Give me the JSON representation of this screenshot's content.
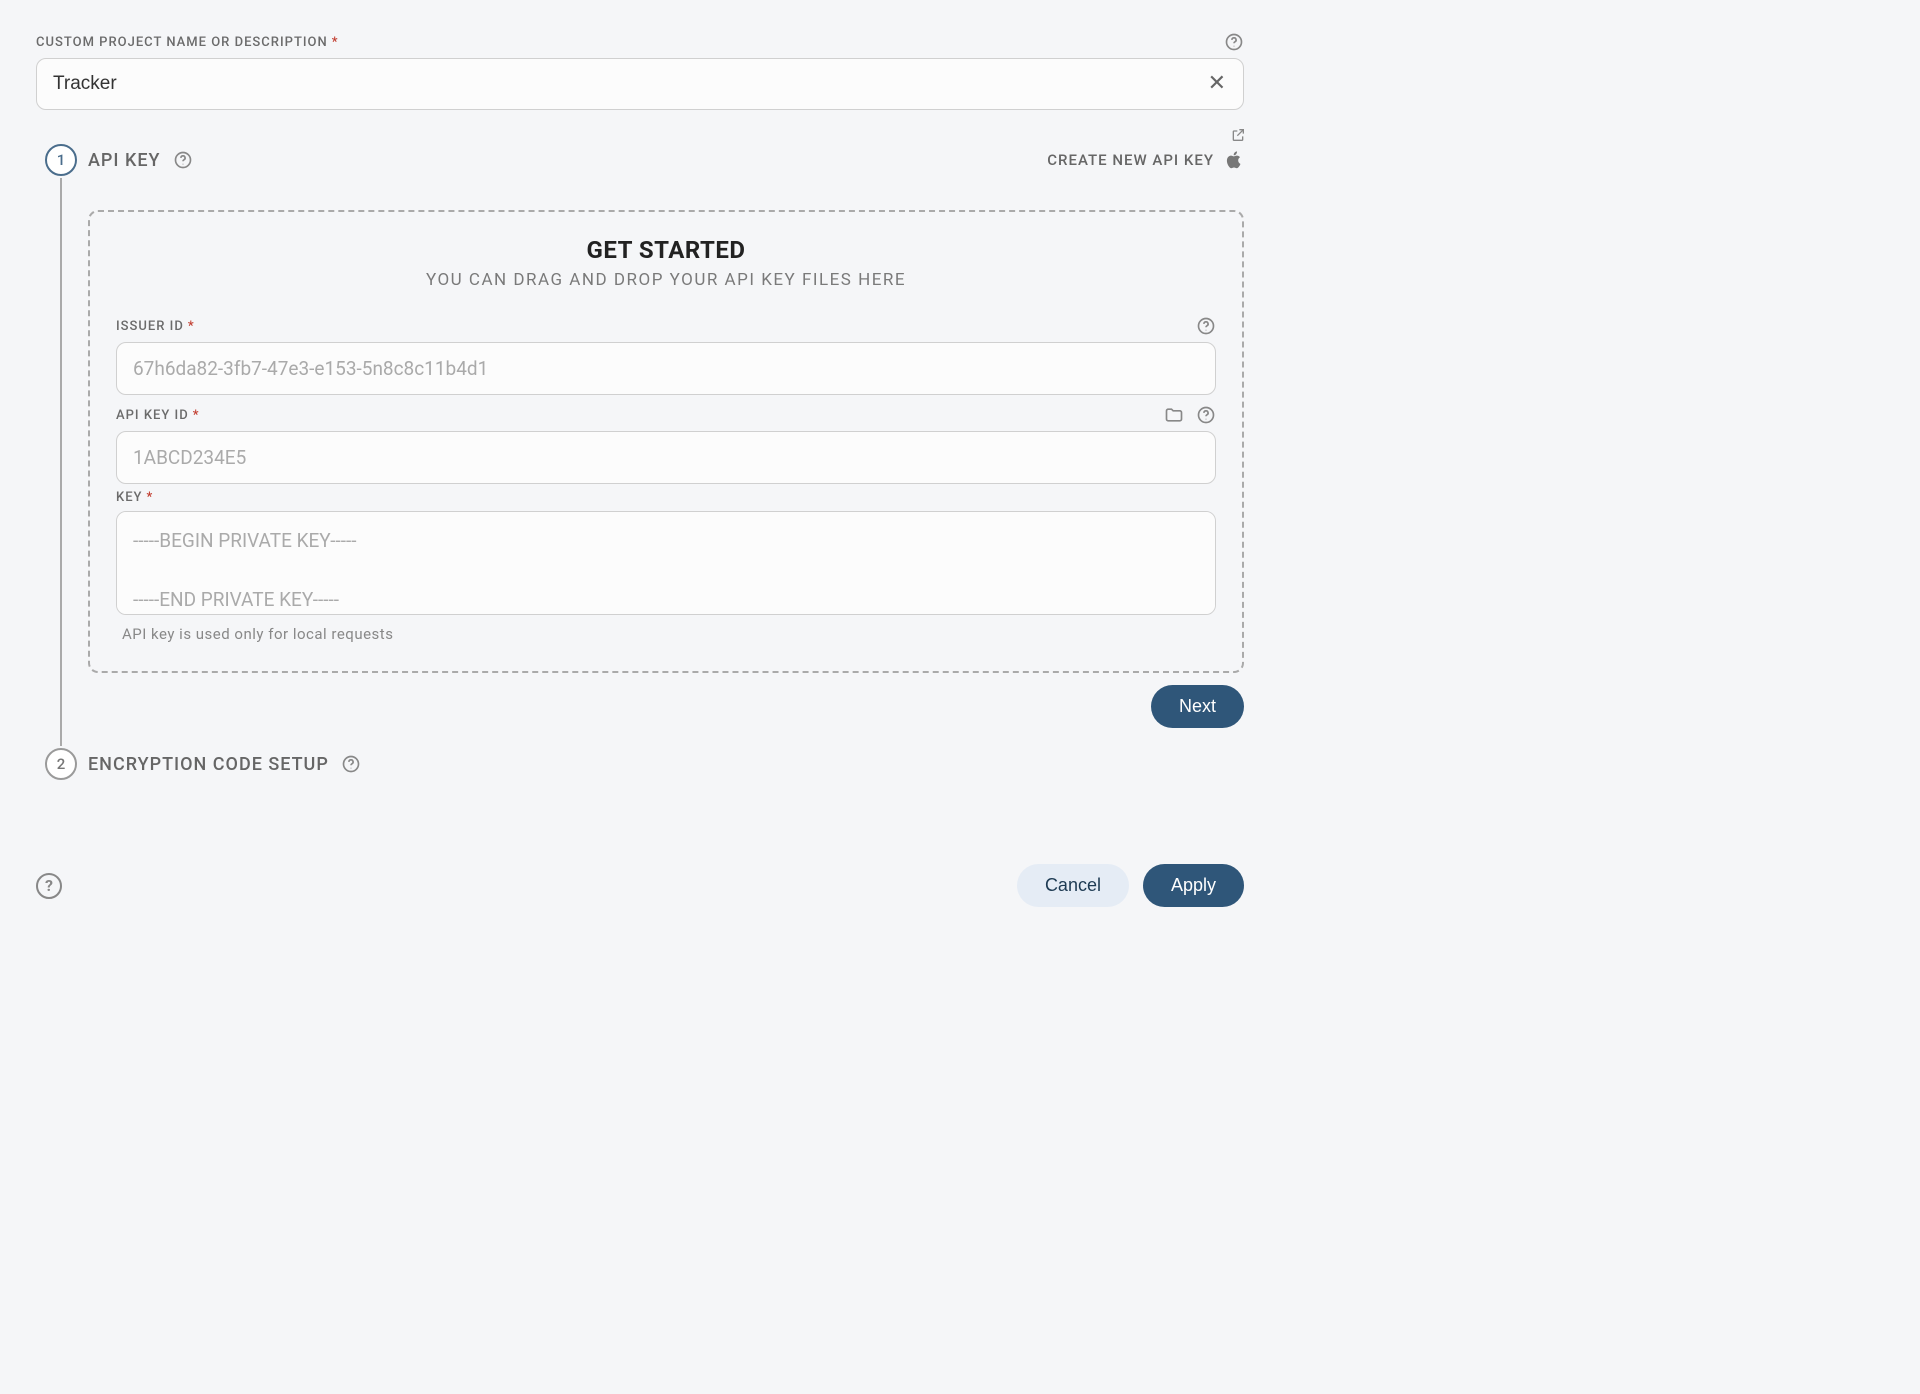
{
  "projectName": {
    "label": "CUSTOM PROJECT NAME OR DESCRIPTION",
    "value": "Tracker"
  },
  "step1": {
    "number": "1",
    "title": "API KEY",
    "createLink": "CREATE NEW API KEY",
    "dropzone": {
      "title": "GET STARTED",
      "subtitle": "YOU CAN DRAG AND DROP YOUR API KEY FILES HERE",
      "issuerId": {
        "label": "ISSUER ID",
        "placeholder": "67h6da82-3fb7-47e3-e153-5n8c8c11b4d1"
      },
      "apiKeyId": {
        "label": "API KEY ID",
        "placeholder": "1ABCD234E5"
      },
      "key": {
        "label": "KEY",
        "placeholder": "-----BEGIN PRIVATE KEY-----\n\n-----END PRIVATE KEY-----"
      },
      "hint": "API key is used only for local requests"
    },
    "nextLabel": "Next"
  },
  "step2": {
    "number": "2",
    "title": "ENCRYPTION CODE SETUP"
  },
  "footer": {
    "cancel": "Cancel",
    "apply": "Apply"
  }
}
